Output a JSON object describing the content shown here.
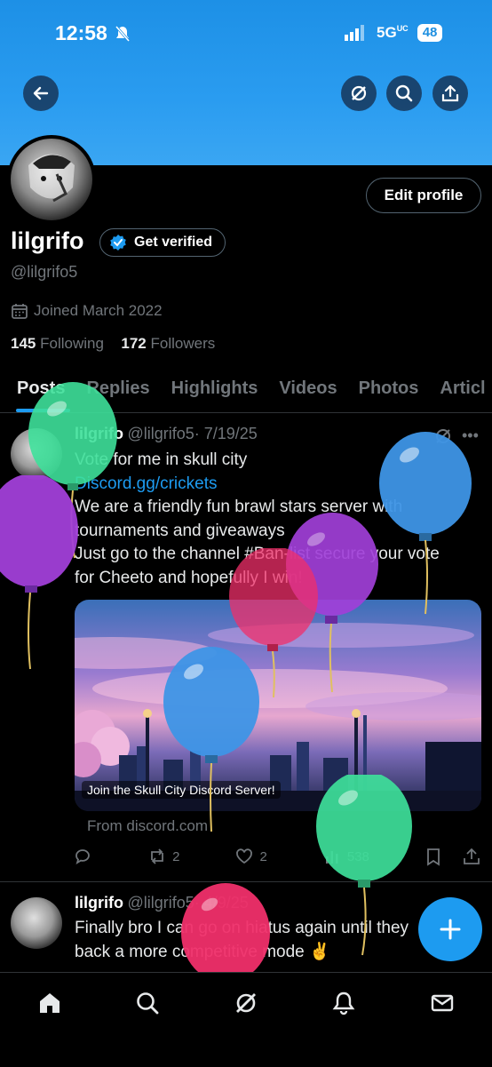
{
  "status_bar": {
    "time": "12:58",
    "network": "5G",
    "network_suffix": "UC",
    "battery": "48"
  },
  "header": {
    "back_icon": "arrow-left-icon",
    "grok_icon": "slash-circle-icon",
    "search_icon": "search-icon",
    "share_icon": "share-icon",
    "banner_color": "#1d90e6"
  },
  "profile": {
    "display_name": "lilgrifo",
    "handle": "@lilgrifo5",
    "edit_label": "Edit profile",
    "verify_label": "Get verified",
    "joined": "Joined March 2022",
    "following_count": "145",
    "following_label": "Following",
    "followers_count": "172",
    "followers_label": "Followers"
  },
  "tabs": [
    "Posts",
    "Replies",
    "Highlights",
    "Videos",
    "Photos",
    "Articl"
  ],
  "posts": [
    {
      "name": "lilgrifo",
      "handle": "@lilgrifo5",
      "date": "· 7/19/25",
      "lines": [
        "Vote for me in skull city",
        "Discord.gg/crickets",
        "We are a friendly fun brawl stars server with",
        "tournaments and giveaways",
        "Just go to the channel #Ban-list secure your vote",
        "for Cheeto and hopefully I win!"
      ],
      "card_caption": "Join the Skull City Discord Server!",
      "card_source": "From discord.com",
      "replies": "",
      "reposts": "2",
      "likes": "2",
      "views": "538"
    },
    {
      "name": "lilgrifo",
      "handle": "@lilgrifo5",
      "date": "· 4/9/25",
      "lines": [
        "Finally bro I can go on hiatus again until they",
        "back a more competitive mode ✌️"
      ]
    }
  ],
  "fab": {
    "icon": "plus-icon"
  },
  "bottom_nav": [
    "home-icon",
    "search-icon",
    "grok-icon",
    "bell-icon",
    "mail-icon"
  ],
  "colors": {
    "accent": "#1d9bf0",
    "background": "#000000",
    "muted": "#71767b"
  }
}
